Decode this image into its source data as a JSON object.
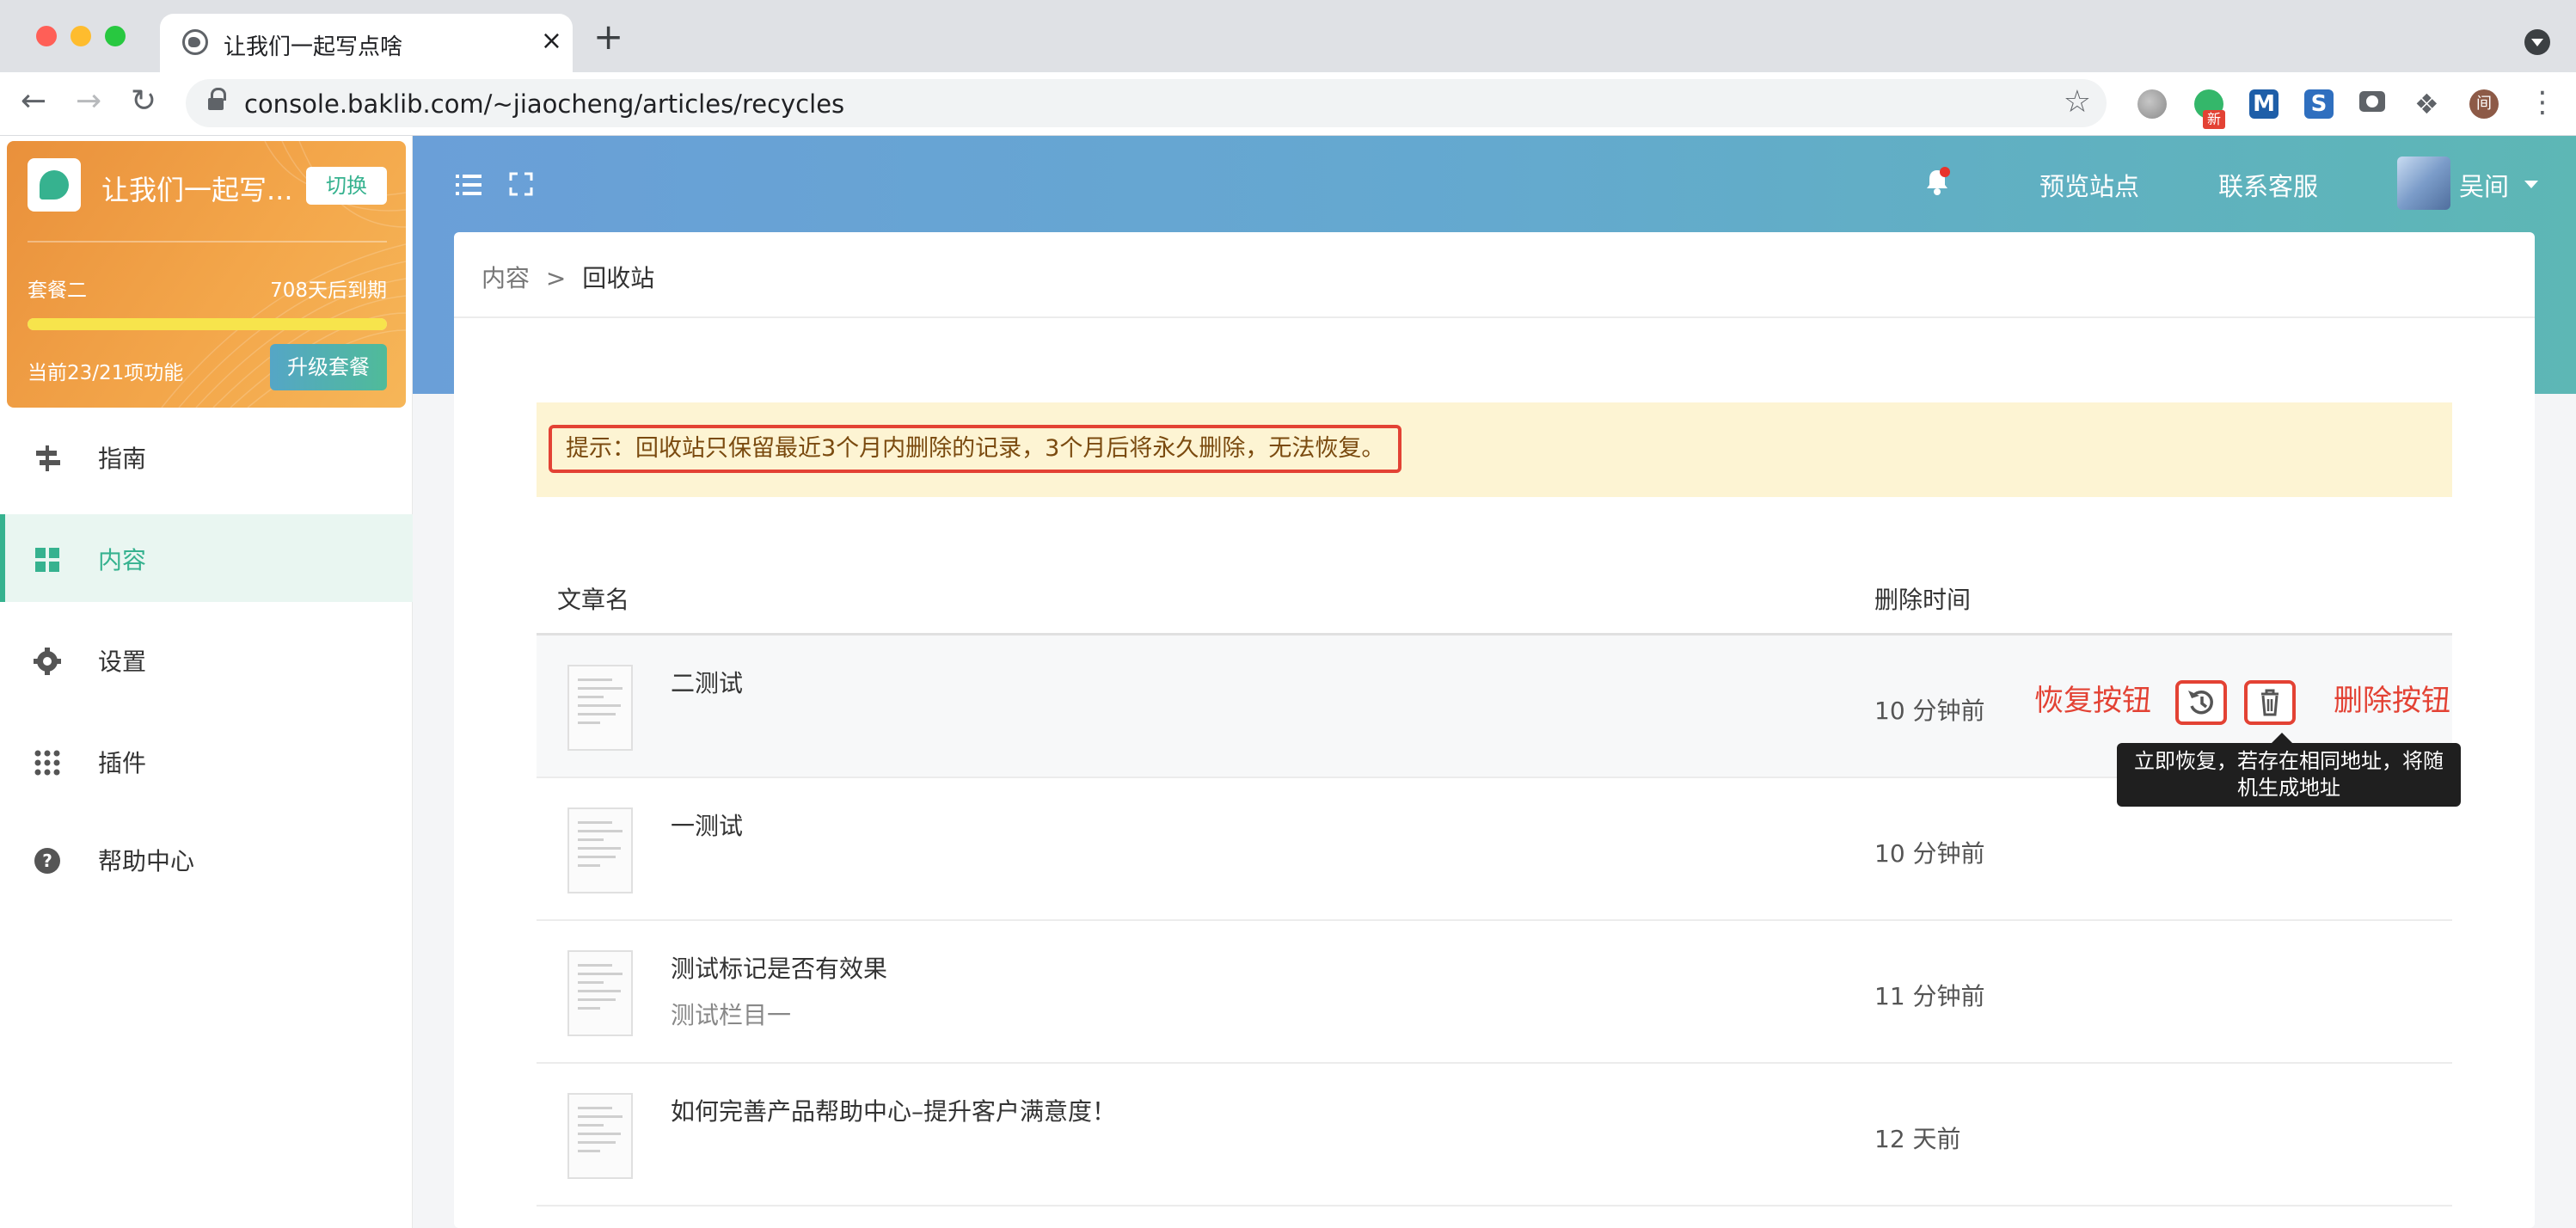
{
  "browser": {
    "tab_title": "让我们一起写点啥",
    "tab_close": "×",
    "new_tab": "+",
    "url": "console.baklib.com/~jiaocheng/articles/recycles",
    "ext_badge": "新",
    "ext_m": "M",
    "ext_s": "S",
    "profile_initial": "间"
  },
  "site_card": {
    "name": "让我们一起写...",
    "switch_label": "切换",
    "plan": "套餐二",
    "expire": "708天后到期",
    "features": "当前23/21项功能",
    "upgrade_label": "升级套餐",
    "progress_fraction": 1.0
  },
  "nav": {
    "items": [
      {
        "label": "指南",
        "icon": "signpost-icon"
      },
      {
        "label": "内容",
        "icon": "grid-icon",
        "active": true
      },
      {
        "label": "设置",
        "icon": "gear-icon"
      },
      {
        "label": "插件",
        "icon": "dots-grid-icon"
      },
      {
        "label": "帮助中心",
        "icon": "help-icon"
      }
    ]
  },
  "header": {
    "preview_site": "预览站点",
    "contact_support": "联系客服",
    "user_name": "吴间"
  },
  "breadcrumb": {
    "parent": "内容",
    "separator": ">",
    "current": "回收站"
  },
  "notice": {
    "text": "提示：回收站只保留最近3个月内删除的记录，3个月后将永久删除，无法恢复。"
  },
  "table": {
    "columns": [
      "文章名",
      "删除时间"
    ],
    "rows": [
      {
        "title": "二测试",
        "subtitle": "",
        "deleted": "10 分钟前"
      },
      {
        "title": "一测试",
        "subtitle": "",
        "deleted": "10 分钟前"
      },
      {
        "title": "测试标记是否有效果",
        "subtitle": "测试栏目一",
        "deleted": "11 分钟前"
      },
      {
        "title": "如何完善产品帮助中心–提升客户满意度！",
        "subtitle": "",
        "deleted": "12 天前"
      }
    ]
  },
  "annotations": {
    "restore_label": "恢复按钮",
    "delete_label": "删除按钮"
  },
  "tooltip": {
    "line1": "立即恢复，若存在相同地址，将随",
    "line2": "机生成地址"
  },
  "colors": {
    "accent": "#36b28f",
    "annotation_red": "#e34234",
    "notice_bg": "#fdf4d3"
  }
}
